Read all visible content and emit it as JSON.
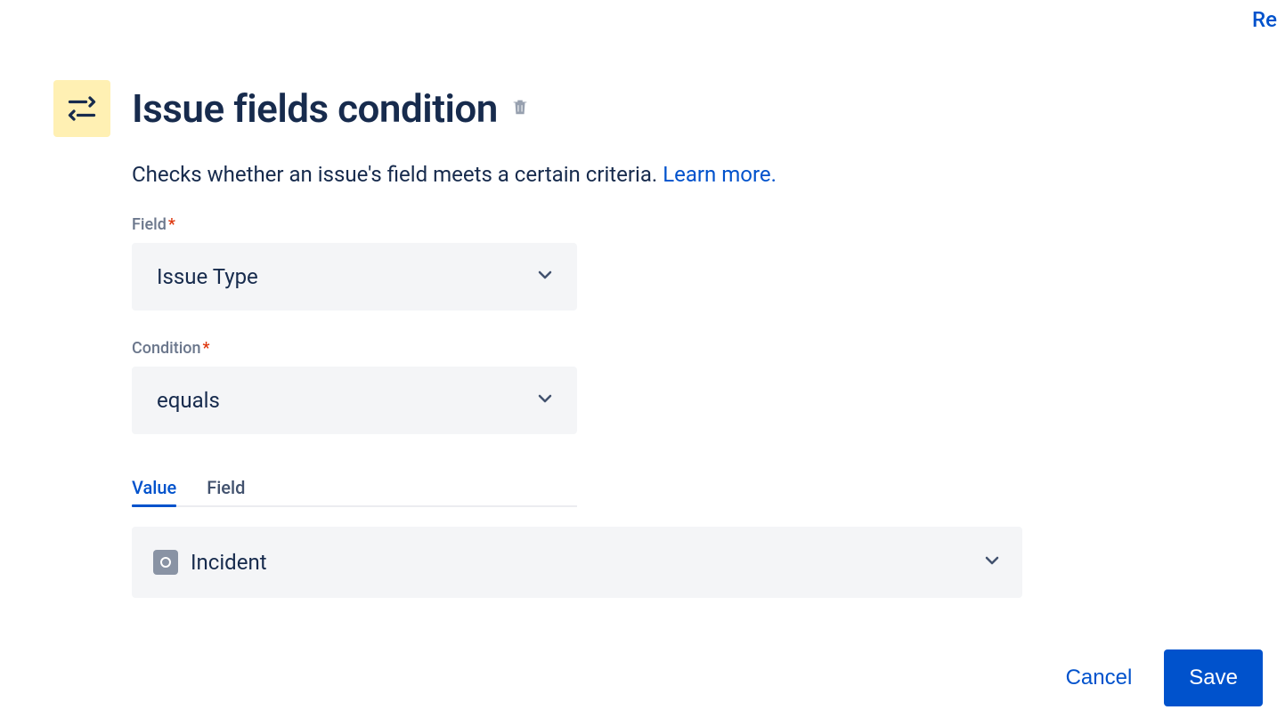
{
  "topRight": {
    "partial_text": "Re"
  },
  "header": {
    "title": "Issue fields condition"
  },
  "description": {
    "text": "Checks whether an issue's field meets a certain criteria. ",
    "learn_more": "Learn more."
  },
  "form": {
    "field": {
      "label": "Field",
      "value": "Issue Type"
    },
    "condition": {
      "label": "Condition",
      "value": "equals"
    }
  },
  "tabs": {
    "value": "Value",
    "field": "Field"
  },
  "valueSelect": {
    "value": "Incident"
  },
  "buttons": {
    "cancel": "Cancel",
    "save": "Save"
  }
}
